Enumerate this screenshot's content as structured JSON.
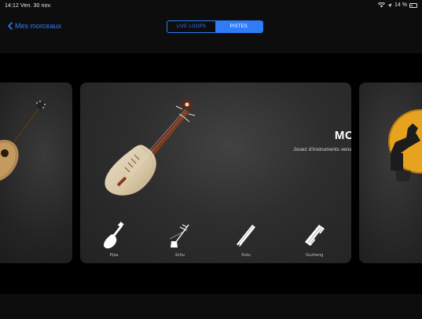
{
  "status_bar": {
    "time": "14:12  Ven. 30 nov.",
    "battery": "14 %",
    "icons": [
      "wifi-icon",
      "location-icon",
      "battery-icon"
    ]
  },
  "nav": {
    "back_label": "Mes morceaux",
    "segments": [
      {
        "label": "LIVE LOOPS",
        "active": false
      },
      {
        "label": "PISTES",
        "active": true
      }
    ]
  },
  "cards": {
    "main": {
      "title": "MONDE",
      "subtitle": "Jouez d’instruments venant des quatre coins du monde.",
      "instruments": [
        {
          "label": "Pipa",
          "icon": "pipa-icon"
        },
        {
          "label": "Erhu",
          "icon": "erhu-icon"
        },
        {
          "label": "Koto",
          "icon": "koto-icon"
        },
        {
          "label": "Guzheng",
          "icon": "guzheng-icon"
        }
      ]
    },
    "left_icon": "guitar-image",
    "right_icon": "drum-image"
  },
  "colors": {
    "accent": "#2f7cf6",
    "background": "#000000",
    "card": "#2e2e2e"
  }
}
